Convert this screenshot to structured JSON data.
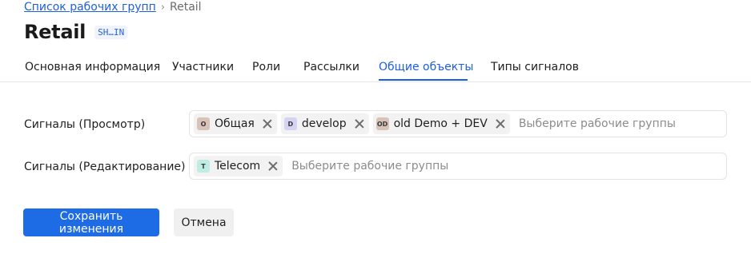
{
  "breadcrumb": {
    "parent_label": "Список рабочих групп",
    "separator": "›",
    "current_label": "Retail"
  },
  "header": {
    "title": "Retail",
    "code_badge": "SH…IN"
  },
  "tabs": [
    {
      "label": "Основная информация",
      "active": false
    },
    {
      "label": "Участники",
      "active": false
    },
    {
      "label": "Роли",
      "active": false
    },
    {
      "label": "Рассылки",
      "active": false
    },
    {
      "label": "Общие объекты",
      "active": true
    },
    {
      "label": "Типы сигналов",
      "active": false
    }
  ],
  "form": {
    "rows": [
      {
        "label": "Сигналы (Просмотр)",
        "placeholder": "Выберите рабочие группы",
        "chips": [
          {
            "initials": "О",
            "label": "Общая",
            "color": "#d9c3b9"
          },
          {
            "initials": "D",
            "label": "develop",
            "color": "#d4d3f2"
          },
          {
            "initials": "OD",
            "label": "old Demo + DEV",
            "color": "#d9c3b9"
          }
        ]
      },
      {
        "label": "Сигналы (Редактирование)",
        "placeholder": "Выберите рабочие группы",
        "chips": [
          {
            "initials": "T",
            "label": "Telecom",
            "color": "#bfece3"
          }
        ]
      }
    ]
  },
  "actions": {
    "save_label": "Сохранить изменения",
    "cancel_label": "Отмена"
  },
  "colors": {
    "accent": "#1d5fe0",
    "primary_button": "#1e6be6"
  }
}
